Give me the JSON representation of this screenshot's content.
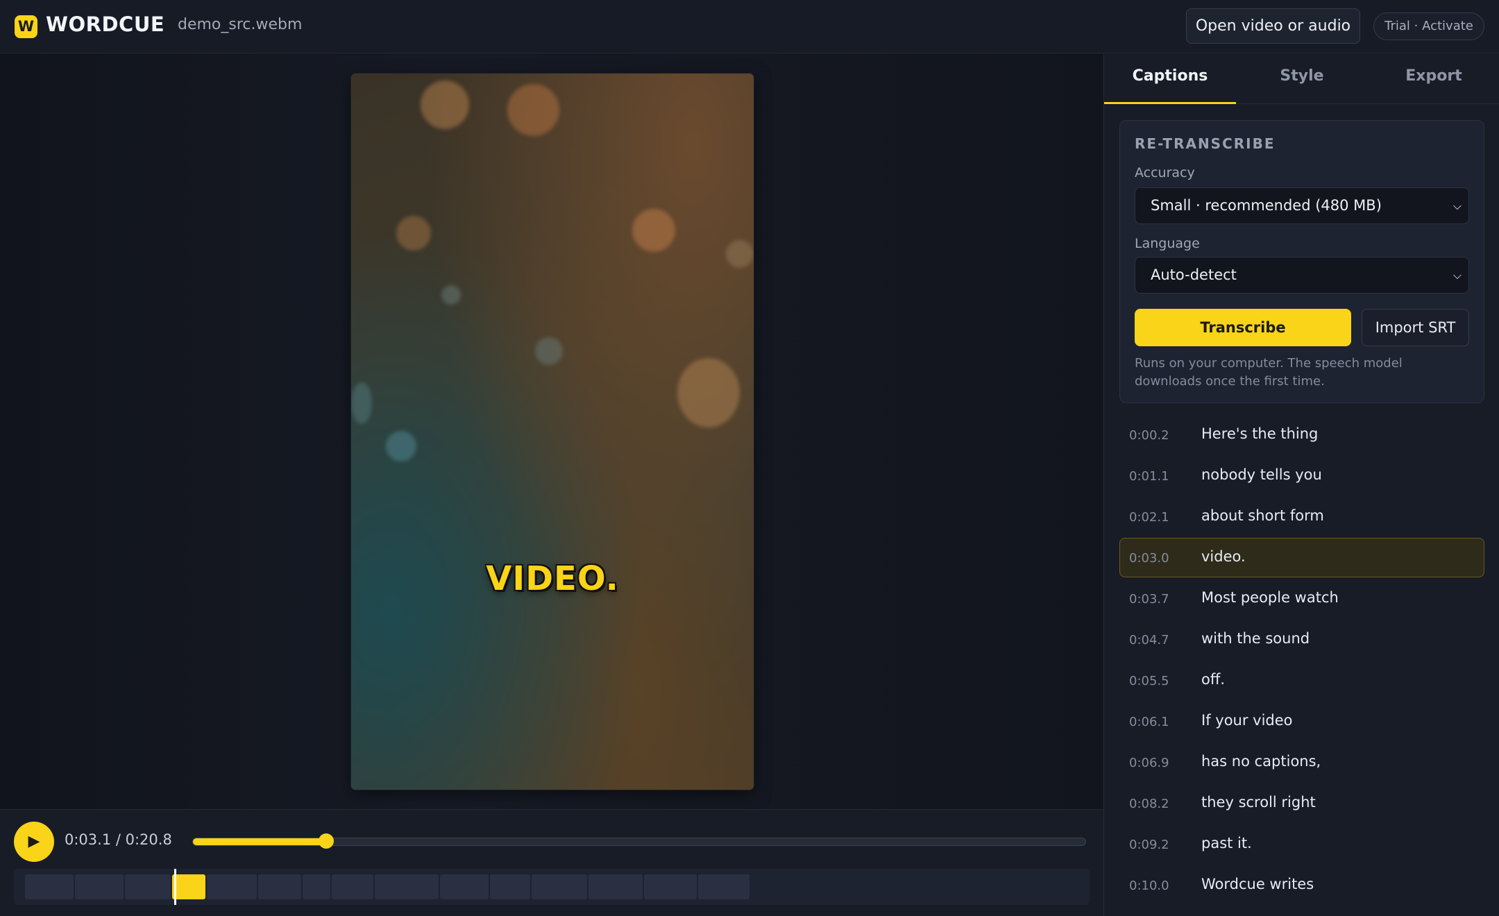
{
  "header": {
    "logo_letter": "W",
    "app_name": "WORDCUE",
    "file_name": "demo_src.webm",
    "open_label": "Open video or audio",
    "trial_label": "Trial · Activate"
  },
  "video": {
    "caption_word": "VIDEO."
  },
  "player": {
    "play_icon": "▶",
    "timecode": "0:03.1 / 0:20.8",
    "progress_fraction": 0.149
  },
  "sidebar": {
    "tabs": [
      {
        "label": "Captions",
        "active": true
      },
      {
        "label": "Style",
        "active": false
      },
      {
        "label": "Export",
        "active": false
      }
    ],
    "retranscribe": {
      "title": "RE-TRANSCRIBE",
      "accuracy_label": "Accuracy",
      "accuracy_value": "Small · recommended (480 MB)",
      "language_label": "Language",
      "language_value": "Auto-detect",
      "transcribe_label": "Transcribe",
      "import_label": "Import SRT",
      "note": "Runs on your computer. The speech model downloads once the first time."
    },
    "cues": [
      {
        "time": "0:00.2",
        "text": "Here's the thing",
        "active": false
      },
      {
        "time": "0:01.1",
        "text": "nobody tells you",
        "active": false
      },
      {
        "time": "0:02.1",
        "text": "about short form",
        "active": false
      },
      {
        "time": "0:03.0",
        "text": "video.",
        "active": true
      },
      {
        "time": "0:03.7",
        "text": "Most people watch",
        "active": false
      },
      {
        "time": "0:04.7",
        "text": "with the sound",
        "active": false
      },
      {
        "time": "0:05.5",
        "text": "off.",
        "active": false
      },
      {
        "time": "0:06.1",
        "text": "If your video",
        "active": false
      },
      {
        "time": "0:06.9",
        "text": "has no captions,",
        "active": false
      },
      {
        "time": "0:08.2",
        "text": "they scroll right",
        "active": false
      },
      {
        "time": "0:09.2",
        "text": "past it.",
        "active": false
      },
      {
        "time": "0:10.0",
        "text": "Wordcue writes",
        "active": false
      }
    ]
  },
  "colors": {
    "accent": "#f9d418",
    "background": "#12151e",
    "panel": "#181c27"
  }
}
